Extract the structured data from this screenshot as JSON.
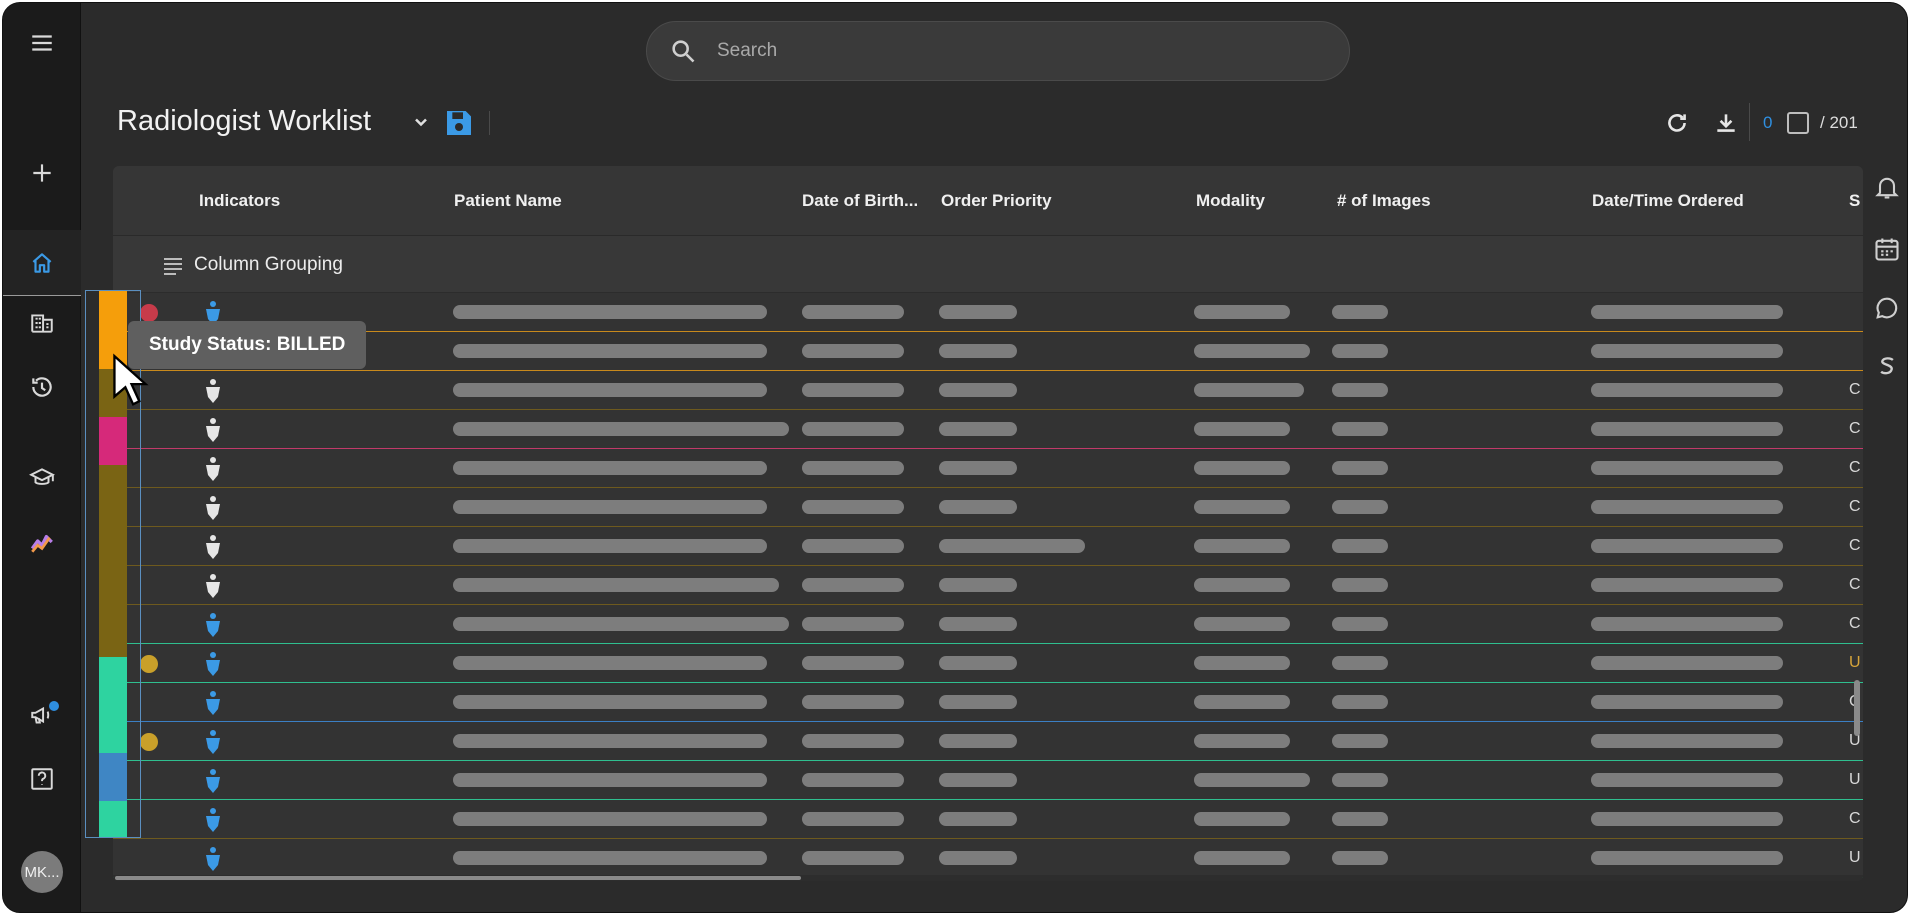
{
  "nav": {
    "items": [
      {
        "name": "menu",
        "icon": "menu-icon"
      },
      {
        "name": "add",
        "icon": "plus-icon"
      },
      {
        "name": "home",
        "icon": "home-icon",
        "active": true
      },
      {
        "name": "worklists",
        "icon": "building-icon"
      },
      {
        "name": "history",
        "icon": "history-icon"
      },
      {
        "name": "teaching",
        "icon": "graduation-cap-icon"
      },
      {
        "name": "analytics",
        "icon": "analytics-icon"
      },
      {
        "name": "announcements",
        "icon": "megaphone-icon",
        "badge": true
      },
      {
        "name": "help",
        "icon": "help-icon"
      }
    ],
    "avatar_initials": "MK..."
  },
  "search": {
    "placeholder": "Search"
  },
  "worklist": {
    "title": "Radiologist Worklist",
    "selected_count": "0",
    "total": "/ 201"
  },
  "grid": {
    "columns": [
      "Indicators",
      "Patient Name",
      "Date of Birth...",
      "Order Priority",
      "Modality",
      "# of Images",
      "Date/Time Ordered",
      "S"
    ],
    "group_bar_label": "Column Grouping",
    "rows": [
      {
        "line": "#c98a1c",
        "ind": "blue",
        "trunc": "",
        "trunc_color": "#d8d8d8"
      },
      {
        "line": "#c98a1c",
        "ind": "white",
        "trunc": "",
        "trunc_color": "#d8d8d8"
      },
      {
        "line": "#6e5a1e",
        "ind": "white",
        "trunc": "C",
        "trunc_color": "#d8d8d8"
      },
      {
        "line": "#c23a6a",
        "ind": "white",
        "trunc": "C",
        "trunc_color": "#d8d8d8"
      },
      {
        "line": "#6e5a1e",
        "ind": "white",
        "trunc": "C",
        "trunc_color": "#d8d8d8"
      },
      {
        "line": "#6e5a1e",
        "ind": "white",
        "trunc": "C",
        "trunc_color": "#d8d8d8"
      },
      {
        "line": "#6e5a1e",
        "ind": "white",
        "trunc": "C",
        "trunc_color": "#d8d8d8"
      },
      {
        "line": "#6e5a1e",
        "ind": "white",
        "trunc": "C",
        "trunc_color": "#d8d8d8"
      },
      {
        "line": "#2fbf8f",
        "ind": "blue",
        "trunc": "C",
        "trunc_color": "#d8d8d8"
      },
      {
        "line": "#2fbf8f",
        "ind": "blue",
        "trunc": "U",
        "trunc_color": "#d6a43a"
      },
      {
        "line": "#3b7fc4",
        "ind": "blue",
        "trunc": "C",
        "trunc_color": "#d8d8d8"
      },
      {
        "line": "#2fbf8f",
        "ind": "blue",
        "trunc": "U",
        "trunc_color": "#d8d8d8"
      },
      {
        "line": "#2fbf8f",
        "ind": "blue",
        "trunc": "U",
        "trunc_color": "#d8d8d8"
      },
      {
        "line": "#6e5a1e",
        "ind": "blue",
        "trunc": "C",
        "trunc_color": "#d8d8d8"
      },
      {
        "line": "#2fa06a",
        "ind": "blue",
        "trunc": "U",
        "trunc_color": "#d8d8d8"
      }
    ]
  },
  "status_strip": {
    "colors": [
      "#f59e0b",
      "#7a6414",
      "#d6297a",
      "#7a6414",
      "#2ed3a0",
      "#3f86c4",
      "#2ed3a0"
    ],
    "tooltip": "Study Status: BILLED"
  },
  "right_rail": {
    "items": [
      "bell-icon",
      "calendar-icon",
      "chat-icon",
      "s-logo-icon"
    ]
  }
}
